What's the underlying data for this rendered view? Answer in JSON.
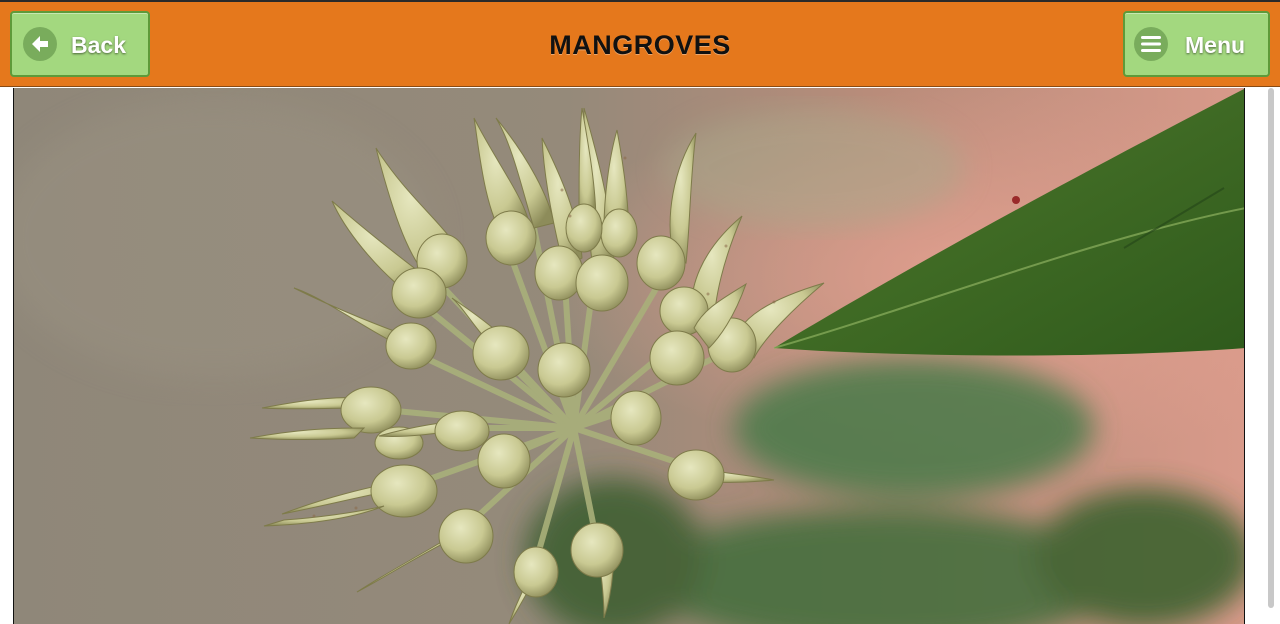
{
  "header": {
    "title": "MANGROVES",
    "back_label": "Back",
    "menu_label": "Menu"
  },
  "colors": {
    "header_bg": "#e5781c",
    "button_bg": "#a3d87f",
    "button_border": "#5e9a3a"
  },
  "icons": {
    "back": "arrow-left-circle-icon",
    "menu": "hamburger-icon"
  }
}
